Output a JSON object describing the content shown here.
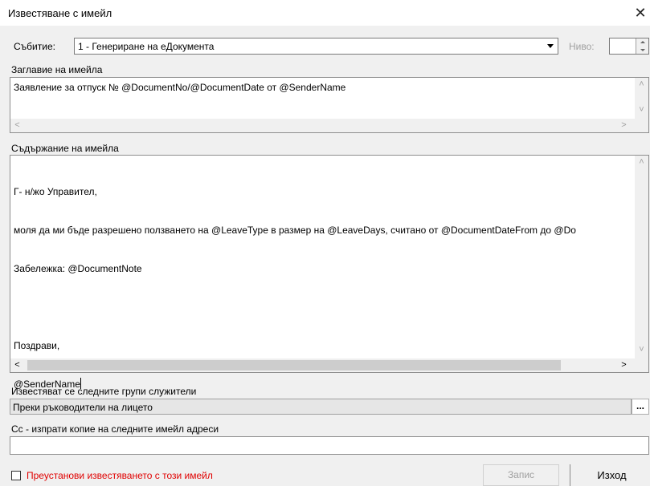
{
  "window": {
    "title": "Известяване с имейл"
  },
  "event": {
    "label": "Събитие:",
    "value": "1 - Генериране на еДокумента"
  },
  "level": {
    "label": "Ниво:",
    "value": ""
  },
  "subject": {
    "label": "Заглавие на имейла",
    "value": "Заявление за отпуск № @DocumentNo/@DocumentDate от @SenderName"
  },
  "body": {
    "label": "Съдържание на имейла",
    "lines": [
      "Г- н/жо Управител,",
      "моля да ми бъде разрешено ползването на @LeaveType в размер на @LeaveDays, считано от @DocumentDateFrom до @Do",
      "Забележка: @DocumentNote",
      "",
      "Поздрави,",
      "@SenderName"
    ]
  },
  "groups": {
    "label": "Известяват се следните групи служители",
    "value": "Преки ръководители на лицето",
    "browse_label": "..."
  },
  "cc": {
    "label": "Сс - изпрати копие на следните имейл адреси",
    "value": ""
  },
  "stop_notify": {
    "label": "Преустанови известяването с този имейл",
    "checked": false
  },
  "buttons": {
    "save": "Запис",
    "exit": "Изход"
  },
  "colors": {
    "warning_text": "#e00000",
    "disabled_text": "#a0a0a0"
  }
}
